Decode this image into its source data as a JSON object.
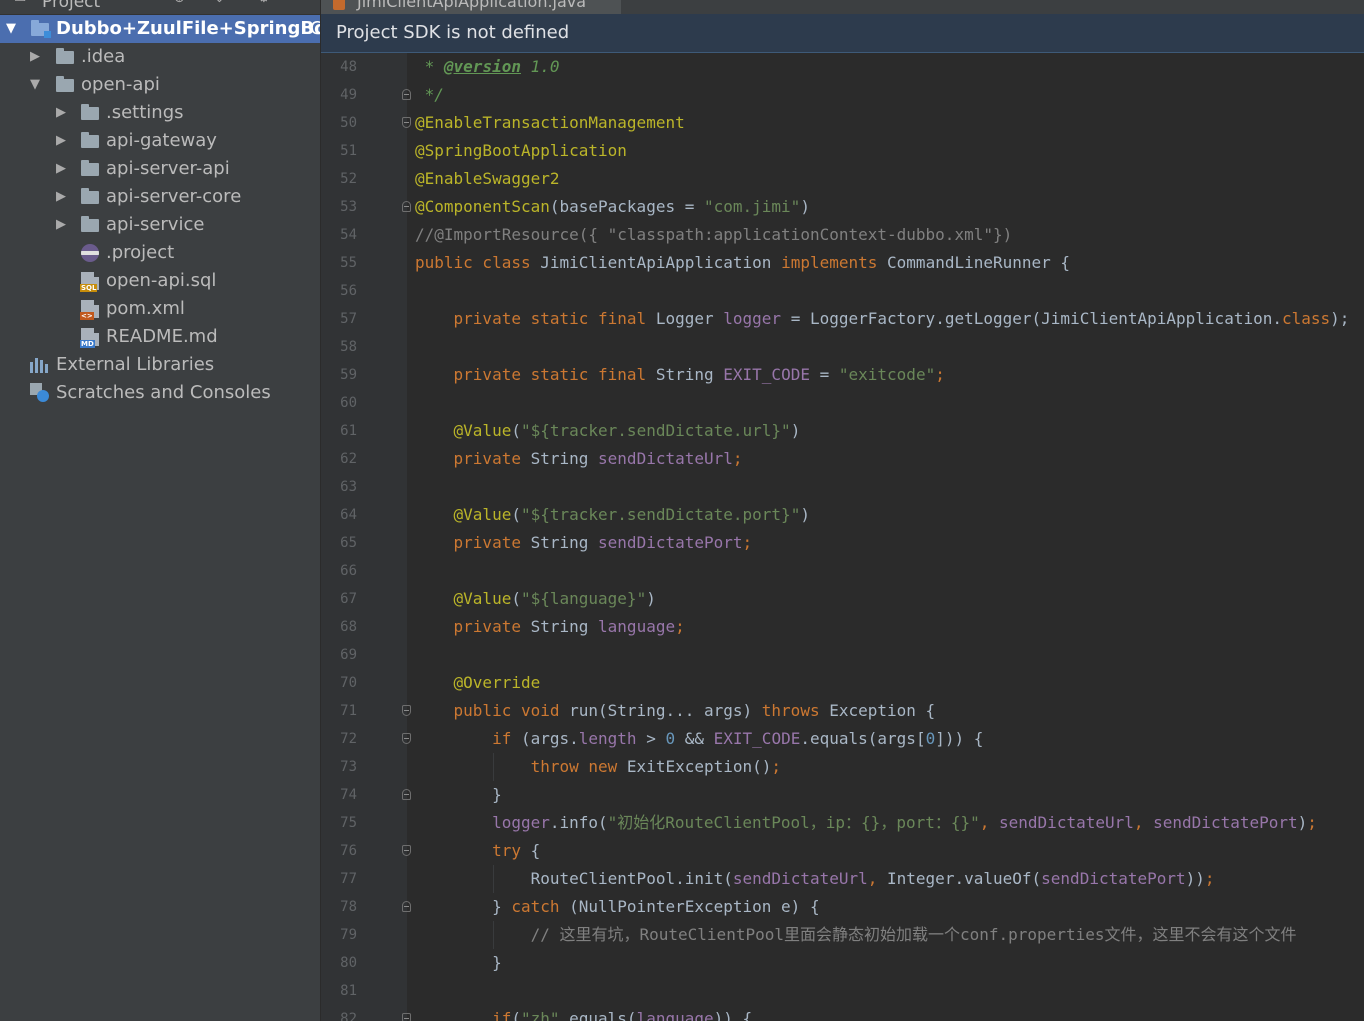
{
  "sidebar": {
    "header_title": "Project",
    "root": {
      "label": "Dubbo+ZuulFile+SpringBoot",
      "suffix": "C"
    },
    "items": [
      {
        "label": ".idea"
      },
      {
        "label": "open-api"
      },
      {
        "label": ".settings"
      },
      {
        "label": "api-gateway"
      },
      {
        "label": "api-server-api"
      },
      {
        "label": "api-server-core"
      },
      {
        "label": "api-service"
      },
      {
        "label": ".project"
      },
      {
        "label": "open-api.sql",
        "badge": "SQL"
      },
      {
        "label": "pom.xml",
        "badge": "<>"
      },
      {
        "label": "README.md",
        "badge": "MD"
      },
      {
        "label": "External Libraries"
      },
      {
        "label": "Scratches and Consoles"
      }
    ]
  },
  "editor": {
    "tab_label": "JimiClientApiApplication.java",
    "banner": "Project SDK is not defined",
    "lines": [
      {
        "num": "48",
        "t": [
          [
            "d",
            " * "
          ],
          [
            "dt",
            "@version"
          ],
          [
            "d",
            " 1.0"
          ]
        ]
      },
      {
        "num": "49",
        "t": [
          [
            "d",
            " */"
          ]
        ]
      },
      {
        "num": "50",
        "t": [
          [
            "a",
            "@EnableTransactionManagement"
          ]
        ]
      },
      {
        "num": "51",
        "t": [
          [
            "a",
            "@SpringBootApplication"
          ]
        ]
      },
      {
        "num": "52",
        "t": [
          [
            "a",
            "@EnableSwagger2"
          ]
        ]
      },
      {
        "num": "53",
        "t": [
          [
            "a",
            "@ComponentScan"
          ],
          [
            "t",
            "(basePackages = "
          ],
          [
            "s",
            "\"com.jimi\""
          ],
          [
            "t",
            ")"
          ]
        ]
      },
      {
        "num": "54",
        "t": [
          [
            "c",
            "//@ImportResource({ \"classpath:applicationContext-dubbo.xml\"})"
          ]
        ]
      },
      {
        "num": "55",
        "t": [
          [
            "k",
            "public class "
          ],
          [
            "t",
            "JimiClientApiApplication "
          ],
          [
            "k",
            "implements "
          ],
          [
            "t",
            "CommandLineRunner {"
          ]
        ]
      },
      {
        "num": "56",
        "t": []
      },
      {
        "num": "57",
        "t": [
          [
            "t",
            "    "
          ],
          [
            "k",
            "private static final "
          ],
          [
            "t",
            "Logger "
          ],
          [
            "m",
            "logger"
          ],
          [
            "t",
            " = LoggerFactory."
          ],
          [
            "t",
            "getLogger"
          ],
          [
            "t",
            "(JimiClientApiApplication."
          ],
          [
            "k",
            "class"
          ],
          [
            "t",
            ");"
          ]
        ]
      },
      {
        "num": "58",
        "t": []
      },
      {
        "num": "59",
        "t": [
          [
            "t",
            "    "
          ],
          [
            "k",
            "private static final "
          ],
          [
            "t",
            "String "
          ],
          [
            "m",
            "EXIT_CODE"
          ],
          [
            "t",
            " = "
          ],
          [
            "s",
            "\"exitcode\""
          ],
          [
            "k",
            ";"
          ]
        ]
      },
      {
        "num": "60",
        "t": []
      },
      {
        "num": "61",
        "t": [
          [
            "t",
            "    "
          ],
          [
            "a",
            "@Value"
          ],
          [
            "t",
            "("
          ],
          [
            "s",
            "\"${tracker.sendDictate.url}\""
          ],
          [
            "t",
            ")"
          ]
        ]
      },
      {
        "num": "62",
        "t": [
          [
            "t",
            "    "
          ],
          [
            "k",
            "private "
          ],
          [
            "t",
            "String "
          ],
          [
            "m",
            "sendDictateUrl"
          ],
          [
            "k",
            ";"
          ]
        ]
      },
      {
        "num": "63",
        "t": []
      },
      {
        "num": "64",
        "t": [
          [
            "t",
            "    "
          ],
          [
            "a",
            "@Value"
          ],
          [
            "t",
            "("
          ],
          [
            "s",
            "\"${tracker.sendDictate.port}\""
          ],
          [
            "t",
            ")"
          ]
        ]
      },
      {
        "num": "65",
        "t": [
          [
            "t",
            "    "
          ],
          [
            "k",
            "private "
          ],
          [
            "t",
            "String "
          ],
          [
            "m",
            "sendDictatePort"
          ],
          [
            "k",
            ";"
          ]
        ]
      },
      {
        "num": "66",
        "t": []
      },
      {
        "num": "67",
        "t": [
          [
            "t",
            "    "
          ],
          [
            "a",
            "@Value"
          ],
          [
            "t",
            "("
          ],
          [
            "s",
            "\"${language}\""
          ],
          [
            "t",
            ")"
          ]
        ]
      },
      {
        "num": "68",
        "t": [
          [
            "t",
            "    "
          ],
          [
            "k",
            "private "
          ],
          [
            "t",
            "String "
          ],
          [
            "m",
            "language"
          ],
          [
            "k",
            ";"
          ]
        ]
      },
      {
        "num": "69",
        "t": []
      },
      {
        "num": "70",
        "t": [
          [
            "t",
            "    "
          ],
          [
            "a",
            "@Override"
          ]
        ]
      },
      {
        "num": "71",
        "t": [
          [
            "t",
            "    "
          ],
          [
            "k",
            "public void "
          ],
          [
            "t",
            "run(String... args) "
          ],
          [
            "k",
            "throws "
          ],
          [
            "t",
            "Exception {"
          ]
        ]
      },
      {
        "num": "72",
        "t": [
          [
            "t",
            "        "
          ],
          [
            "k",
            "if "
          ],
          [
            "t",
            "(args."
          ],
          [
            "m",
            "length"
          ],
          [
            "t",
            " > "
          ],
          [
            "n",
            "0"
          ],
          [
            "t",
            " && "
          ],
          [
            "m",
            "EXIT_CODE"
          ],
          [
            "t",
            ".equals(args["
          ],
          [
            "n",
            "0"
          ],
          [
            "t",
            "])) {"
          ]
        ]
      },
      {
        "num": "73",
        "t": [
          [
            "t",
            "            "
          ],
          [
            "k",
            "throw new "
          ],
          [
            "t",
            "ExitException()"
          ],
          [
            "k",
            ";"
          ]
        ]
      },
      {
        "num": "74",
        "t": [
          [
            "t",
            "        }"
          ]
        ]
      },
      {
        "num": "75",
        "t": [
          [
            "t",
            "        "
          ],
          [
            "m",
            "logger"
          ],
          [
            "t",
            ".info("
          ],
          [
            "s",
            "\"初始化RouteClientPool，ip：{}，port：{}\""
          ],
          [
            "k",
            ", "
          ],
          [
            "m",
            "sendDictateUrl"
          ],
          [
            "k",
            ", "
          ],
          [
            "m",
            "sendDictatePort"
          ],
          [
            "t",
            ")"
          ],
          [
            "k",
            ";"
          ]
        ]
      },
      {
        "num": "76",
        "t": [
          [
            "t",
            "        "
          ],
          [
            "k",
            "try "
          ],
          [
            "t",
            "{"
          ]
        ]
      },
      {
        "num": "77",
        "t": [
          [
            "t",
            "            RouteClientPool."
          ],
          [
            "t",
            "init"
          ],
          [
            "t",
            "("
          ],
          [
            "m",
            "sendDictateUrl"
          ],
          [
            "k",
            ", "
          ],
          [
            "t",
            "Integer."
          ],
          [
            "t",
            "valueOf"
          ],
          [
            "t",
            "("
          ],
          [
            "m",
            "sendDictatePort"
          ],
          [
            "t",
            "))"
          ],
          [
            "k",
            ";"
          ]
        ]
      },
      {
        "num": "78",
        "t": [
          [
            "t",
            "        } "
          ],
          [
            "k",
            "catch "
          ],
          [
            "t",
            "(NullPointerException e) {"
          ]
        ]
      },
      {
        "num": "79",
        "t": [
          [
            "t",
            "            "
          ],
          [
            "c",
            "// 这里有坑，RouteClientPool里面会静态初始加载一个conf.properties文件，这里不会有这个文件"
          ]
        ]
      },
      {
        "num": "80",
        "t": [
          [
            "t",
            "        }"
          ]
        ]
      },
      {
        "num": "81",
        "t": []
      },
      {
        "num": "82",
        "t": [
          [
            "t",
            "        "
          ],
          [
            "k",
            "if"
          ],
          [
            "t",
            "("
          ],
          [
            "s",
            "\"zh\""
          ],
          [
            "t",
            ".equals("
          ],
          [
            "m",
            "language"
          ],
          [
            "t",
            ")) {"
          ]
        ]
      }
    ]
  },
  "colors": {
    "sidebar_bg": "#3c3f41",
    "selection": "#4b6eaf",
    "editor_bg": "#2b2b2b",
    "keyword": "#cc7832",
    "string": "#6a8759",
    "annotation": "#bbb529",
    "comment": "#808080",
    "javadoc": "#629755",
    "number": "#6897bb",
    "field": "#9876aa",
    "text": "#a9b7c6"
  }
}
